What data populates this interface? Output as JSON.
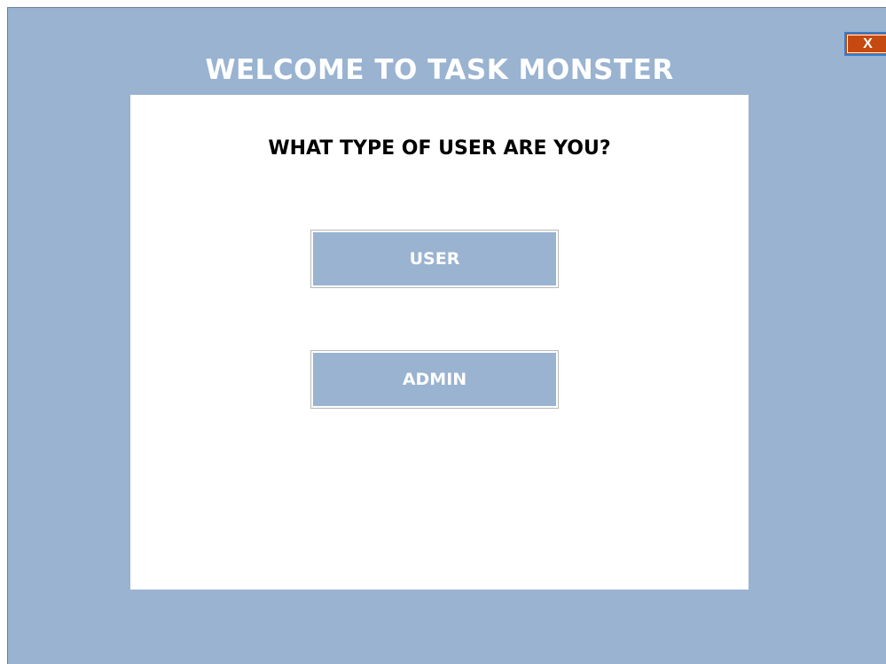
{
  "window": {
    "close_label": "X",
    "title": "WELCOME TO TASK MONSTER"
  },
  "panel": {
    "question": "WHAT TYPE OF USER ARE YOU?",
    "user_button_label": "USER",
    "admin_button_label": "ADMIN"
  },
  "colors": {
    "background": "#99b3d1",
    "panel": "#ffffff",
    "close_button": "#c44a12",
    "button_text": "#ffffff"
  },
  "icons": {
    "close": "close-icon"
  }
}
